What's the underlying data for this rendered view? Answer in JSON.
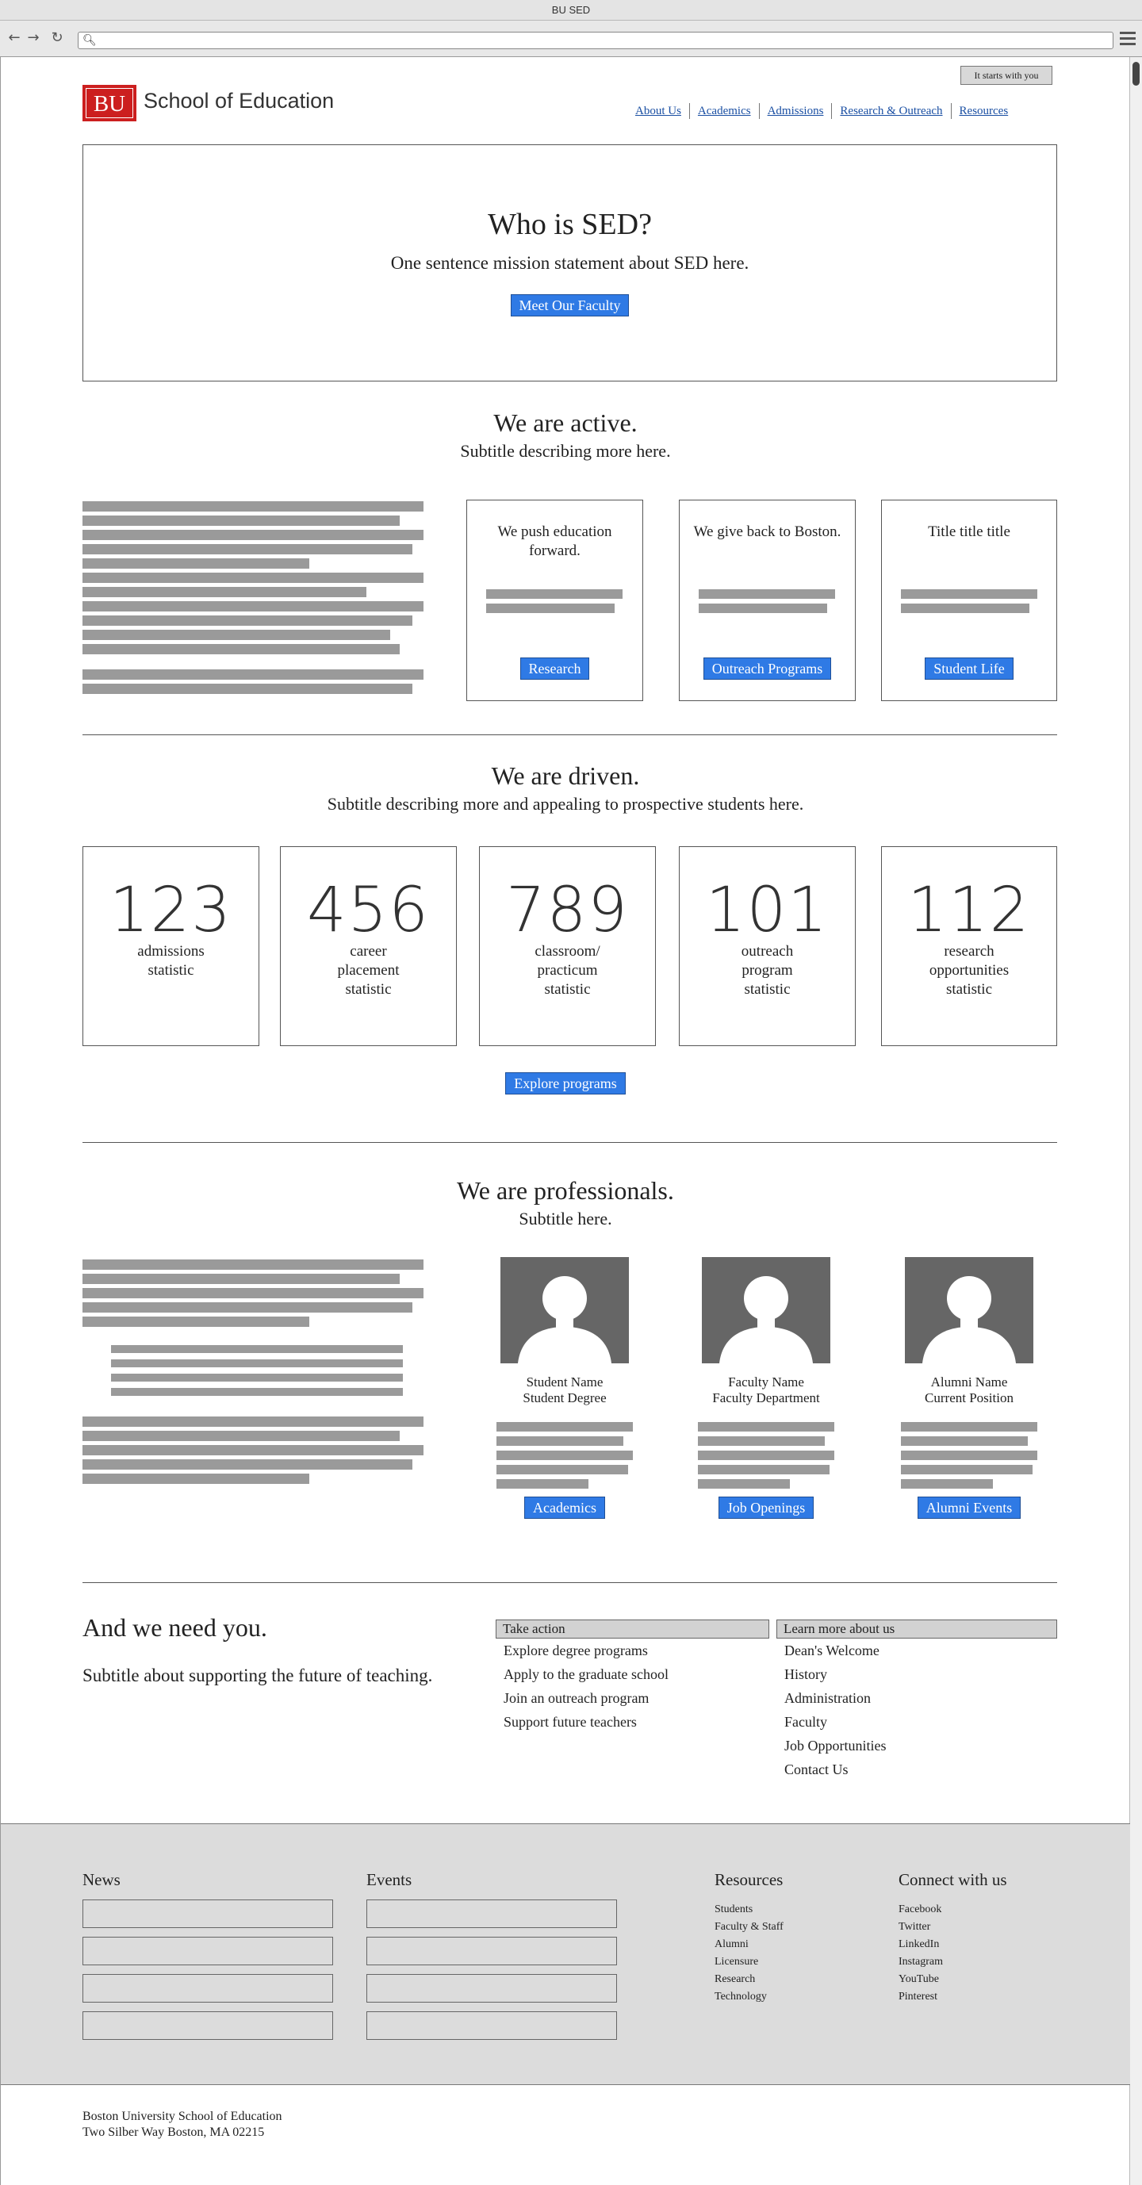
{
  "browser": {
    "window_title": "BU SED"
  },
  "header": {
    "cta_button": "It starts with you",
    "logo_mark": "BU",
    "logo_text": "School of Education",
    "nav": [
      "About Us",
      "Academics",
      "Admissions",
      "Research & Outreach",
      "Resources"
    ]
  },
  "hero": {
    "title": "Who is SED?",
    "mission": "One sentence mission statement about SED here.",
    "button": "Meet Our Faculty"
  },
  "active": {
    "title": "We are active.",
    "subtitle": "Subtitle describing more here.",
    "cards": [
      {
        "title": "We push education forward.",
        "button": "Research"
      },
      {
        "title": "We give back to Boston.",
        "button": "Outreach Programs"
      },
      {
        "title": "Title title title",
        "button": "Student Life"
      }
    ]
  },
  "driven": {
    "title": "We are driven.",
    "subtitle": "Subtitle describing more and appealing to prospective students here.",
    "stats": [
      {
        "value": "123",
        "label": "admissions\nstatistic"
      },
      {
        "value": "456",
        "label": "career\nplacement\nstatistic"
      },
      {
        "value": "789",
        "label": "classroom/\npracticum\nstatistic"
      },
      {
        "value": "101",
        "label": "outreach\nprogram\nstatistic"
      },
      {
        "value": "112",
        "label": "research\nopportunities\nstatistic"
      }
    ],
    "button": "Explore programs"
  },
  "professionals": {
    "title": "We are professionals.",
    "subtitle": "Subtitle here.",
    "people": [
      {
        "name": "Student Name",
        "detail": "Student Degree",
        "button": "Academics"
      },
      {
        "name": "Faculty Name",
        "detail": "Faculty Department",
        "button": "Job Openings"
      },
      {
        "name": "Alumni Name",
        "detail": "Current Position",
        "button": "Alumni Events"
      }
    ]
  },
  "need": {
    "title": "And we need you.",
    "subtitle": "Subtitle about supporting the future of teaching.",
    "take_action": {
      "heading": "Take action",
      "items": [
        "Explore degree programs",
        "Apply to the graduate school",
        "Join an outreach program",
        "Support future teachers"
      ]
    },
    "learn_more": {
      "heading": "Learn more about us",
      "items": [
        "Dean's Welcome",
        "History",
        "Administration",
        "Faculty",
        "Job Opportunities",
        "Contact Us"
      ]
    }
  },
  "footer": {
    "news_heading": "News",
    "events_heading": "Events",
    "resources": {
      "heading": "Resources",
      "items": [
        "Students",
        "Faculty & Staff",
        "Alumni",
        "Licensure",
        "Research",
        "Technology"
      ]
    },
    "connect": {
      "heading": "Connect with us",
      "items": [
        "Facebook",
        "Twitter",
        "LinkedIn",
        "Instagram",
        "YouTube",
        "Pinterest"
      ]
    },
    "address_line1": "Boston University School of Education",
    "address_line2": "Two Silber Way Boston, MA 02215"
  },
  "colors": {
    "button_blue": "#2f7ae5",
    "logo_red": "#cc1f1f",
    "placeholder_gray": "#9a9a9a",
    "footer_gray": "#dcdcdc"
  }
}
